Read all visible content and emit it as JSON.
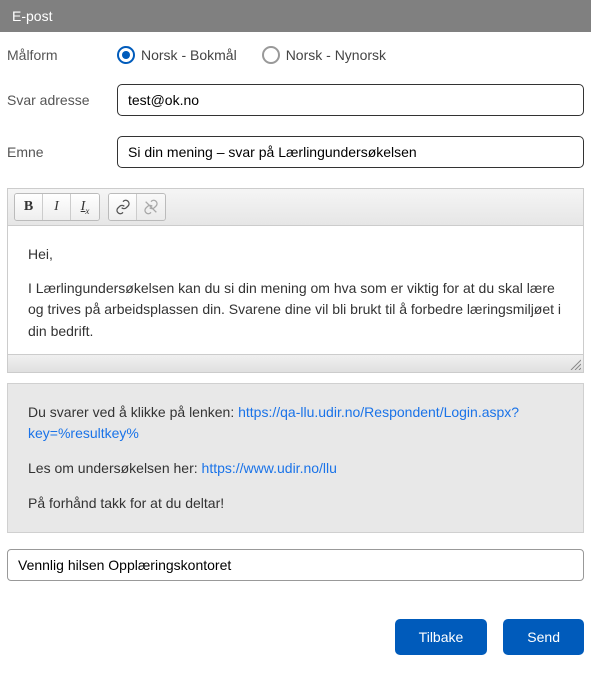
{
  "header": {
    "title": "E-post"
  },
  "form": {
    "malform": {
      "label": "Målform",
      "options": {
        "bokmal": "Norsk - Bokmål",
        "nynorsk": "Norsk - Nynorsk"
      },
      "selected": "bokmal"
    },
    "svar_adresse": {
      "label": "Svar adresse",
      "value": "test@ok.no"
    },
    "emne": {
      "label": "Emne",
      "value": "Si din mening – svar på Lærlingundersøkelsen"
    }
  },
  "editor": {
    "toolbar": {
      "bold": "B",
      "italic": "I",
      "clear": "Ix"
    },
    "body": {
      "greeting": "Hei,",
      "paragraph1": "I Lærlingundersøkelsen kan du si din mening om hva som er viktig for at du skal lære og trives på arbeidsplassen din. Svarene dine vil bli brukt til å forbedre læringsmiljøet i din bedrift."
    }
  },
  "info": {
    "line1_prefix": "Du svarer ved å klikke på lenken: ",
    "link1": "https://qa-llu.udir.no/Respondent/Login.aspx?key=%resultkey%",
    "line2_prefix": "Les om undersøkelsen her: ",
    "link2": "https://www.udir.no/llu",
    "line3": "På forhånd takk for at du deltar!"
  },
  "signature": {
    "value": "Vennlig hilsen Opplæringskontoret"
  },
  "buttons": {
    "back": "Tilbake",
    "send": "Send"
  }
}
